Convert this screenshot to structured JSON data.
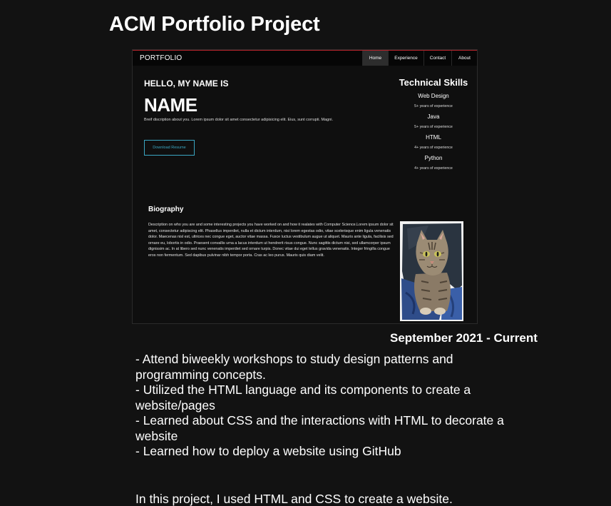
{
  "project_title": "ACM Portfolio Project",
  "preview": {
    "nav": {
      "brand": "PORTFOLIO",
      "links": [
        "Home",
        "Experience",
        "Contact",
        "About"
      ]
    },
    "hero": {
      "greeting": "HELLO, MY NAME IS",
      "name": "NAME",
      "brief": "Breif discription about you. Lorem ipsum dolor sit amet consectetur adipisicing elit. Eius, sunt corrupti. Magni.",
      "resume_button": "Download Resume"
    },
    "skills": {
      "title": "Technical Skills",
      "items": [
        {
          "name": "Web Design",
          "years": "5+ years of experience"
        },
        {
          "name": "Java",
          "years": "5+ years of experience"
        },
        {
          "name": "HTML",
          "years": "4+ years of experience"
        },
        {
          "name": "Python",
          "years": "4+ years of experience"
        }
      ]
    },
    "biography": {
      "title": "Biography",
      "text": "Description on who you are and some interesting projects you have worked on and how it realates with Computer Science.Lorem ipsum dolor sit amet, consectetur adipiscing elit. Phasellus imperdiet, nulla et dictum interdum, nisi lorem egestas odio, vitae scelerisque enim ligula venenatis dolor. Maecenas nisl est, ultrices nec congue eget, auctor vitae massa. Fusce luctus vestibulum augue ut aliquet. Mauris ante ligula, facilisis sed ornare eu, lobortis in odio. Praesent convallis urna a lacus interdum ut hendrerit risus congue. Nunc sagittis dictum nisi, sed ullamcorper ipsum dignissim ac. In at libero sed nunc venenatis imperdiet sed ornare turpis. Donec vitae dui eget tellus gravida venenatis. Integer fringilla congue eros non fermentum. Sed dapibus pulvinar nibh tempor porta. Cras ac leo purus. Mauris quis diam velit."
    }
  },
  "date_range": "September 2021 - Current",
  "bullets": [
    "- Attend biweekly workshops to study design patterns and programming concepts.",
    "- Utilized the HTML language and its components to create a website/pages",
    "- Learned about CSS and the interactions with HTML to decorate a website",
    "- Learned how to deploy a website using GitHub"
  ],
  "summary": "In this project, I used HTML and CSS to create a website."
}
